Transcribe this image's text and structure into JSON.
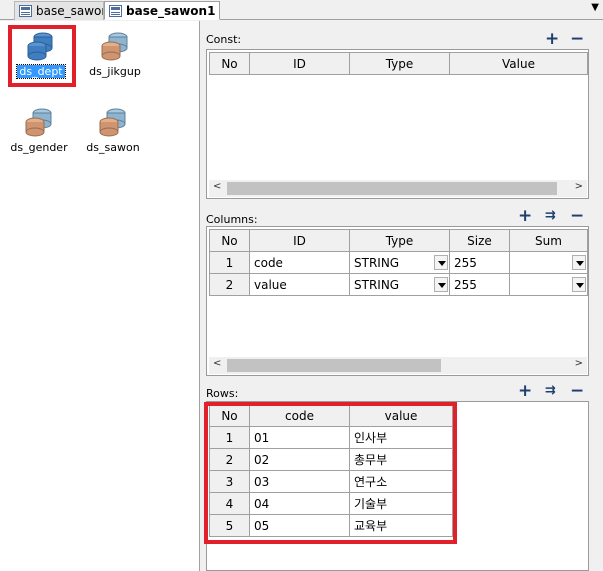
{
  "tabs": [
    {
      "label": "base_sawon",
      "active": false
    },
    {
      "label": "base_sawon1 *",
      "active": true
    }
  ],
  "tab_menu_icon": "chevron-down-icon",
  "datasets": [
    {
      "name": "ds_dept",
      "selected": true
    },
    {
      "name": "ds_jikgup",
      "selected": false
    },
    {
      "name": "ds_gender",
      "selected": false
    },
    {
      "name": "ds_sawon",
      "selected": false
    }
  ],
  "const_panel": {
    "label": "Const:",
    "headers": [
      "No",
      "ID",
      "Type",
      "Value"
    ]
  },
  "columns_panel": {
    "label": "Columns:",
    "headers": [
      "No",
      "ID",
      "Type",
      "Size",
      "Sum"
    ],
    "rows": [
      {
        "no": "1",
        "id": "code",
        "type": "STRING",
        "size": "255",
        "sum": ""
      },
      {
        "no": "2",
        "id": "value",
        "type": "STRING",
        "size": "255",
        "sum": ""
      }
    ]
  },
  "rows_panel": {
    "label": "Rows:",
    "headers": [
      "No",
      "code",
      "value"
    ],
    "rows": [
      {
        "no": "1",
        "code": "01",
        "value": "인사부"
      },
      {
        "no": "2",
        "code": "02",
        "value": "총무부"
      },
      {
        "no": "3",
        "code": "03",
        "value": "연구소"
      },
      {
        "no": "4",
        "code": "04",
        "value": "기술부"
      },
      {
        "no": "5",
        "code": "05",
        "value": "교육부"
      }
    ]
  },
  "buttons": {
    "add": "+",
    "remove": "−"
  },
  "highlight_color": "#e0212a",
  "selection_color": "#3399ff"
}
